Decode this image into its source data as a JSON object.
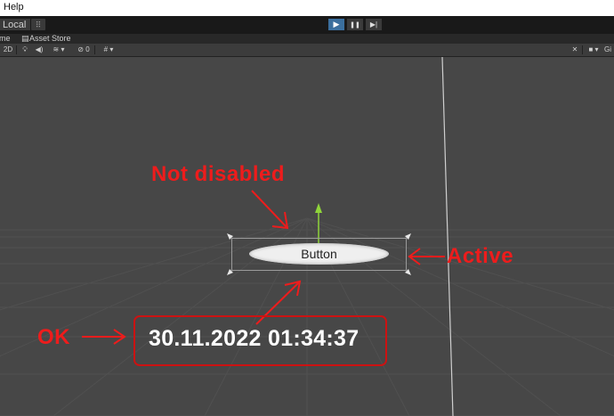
{
  "menu": {
    "help_label": "Help"
  },
  "toolbar": {
    "pivot_label": "Local",
    "play_glyph": "▶",
    "pause_glyph": "❚❚",
    "step_glyph": "▶|"
  },
  "tabs": [
    {
      "label": "me"
    },
    {
      "label": "Asset Store"
    }
  ],
  "scene_toolbar": {
    "mode_2d_label": "2D",
    "hidden_count": "0",
    "gizmos_label": "Gi"
  },
  "scene": {
    "button_label": "Button",
    "datetime_text": "30.11.2022 01:34:37"
  },
  "annotations": {
    "not_disabled": "Not disabled",
    "active": "Active",
    "ok": "OK"
  },
  "colors": {
    "annotation": "#ee1c1c",
    "play_active": "#3b6f9e",
    "scene_bg": "#474747"
  }
}
